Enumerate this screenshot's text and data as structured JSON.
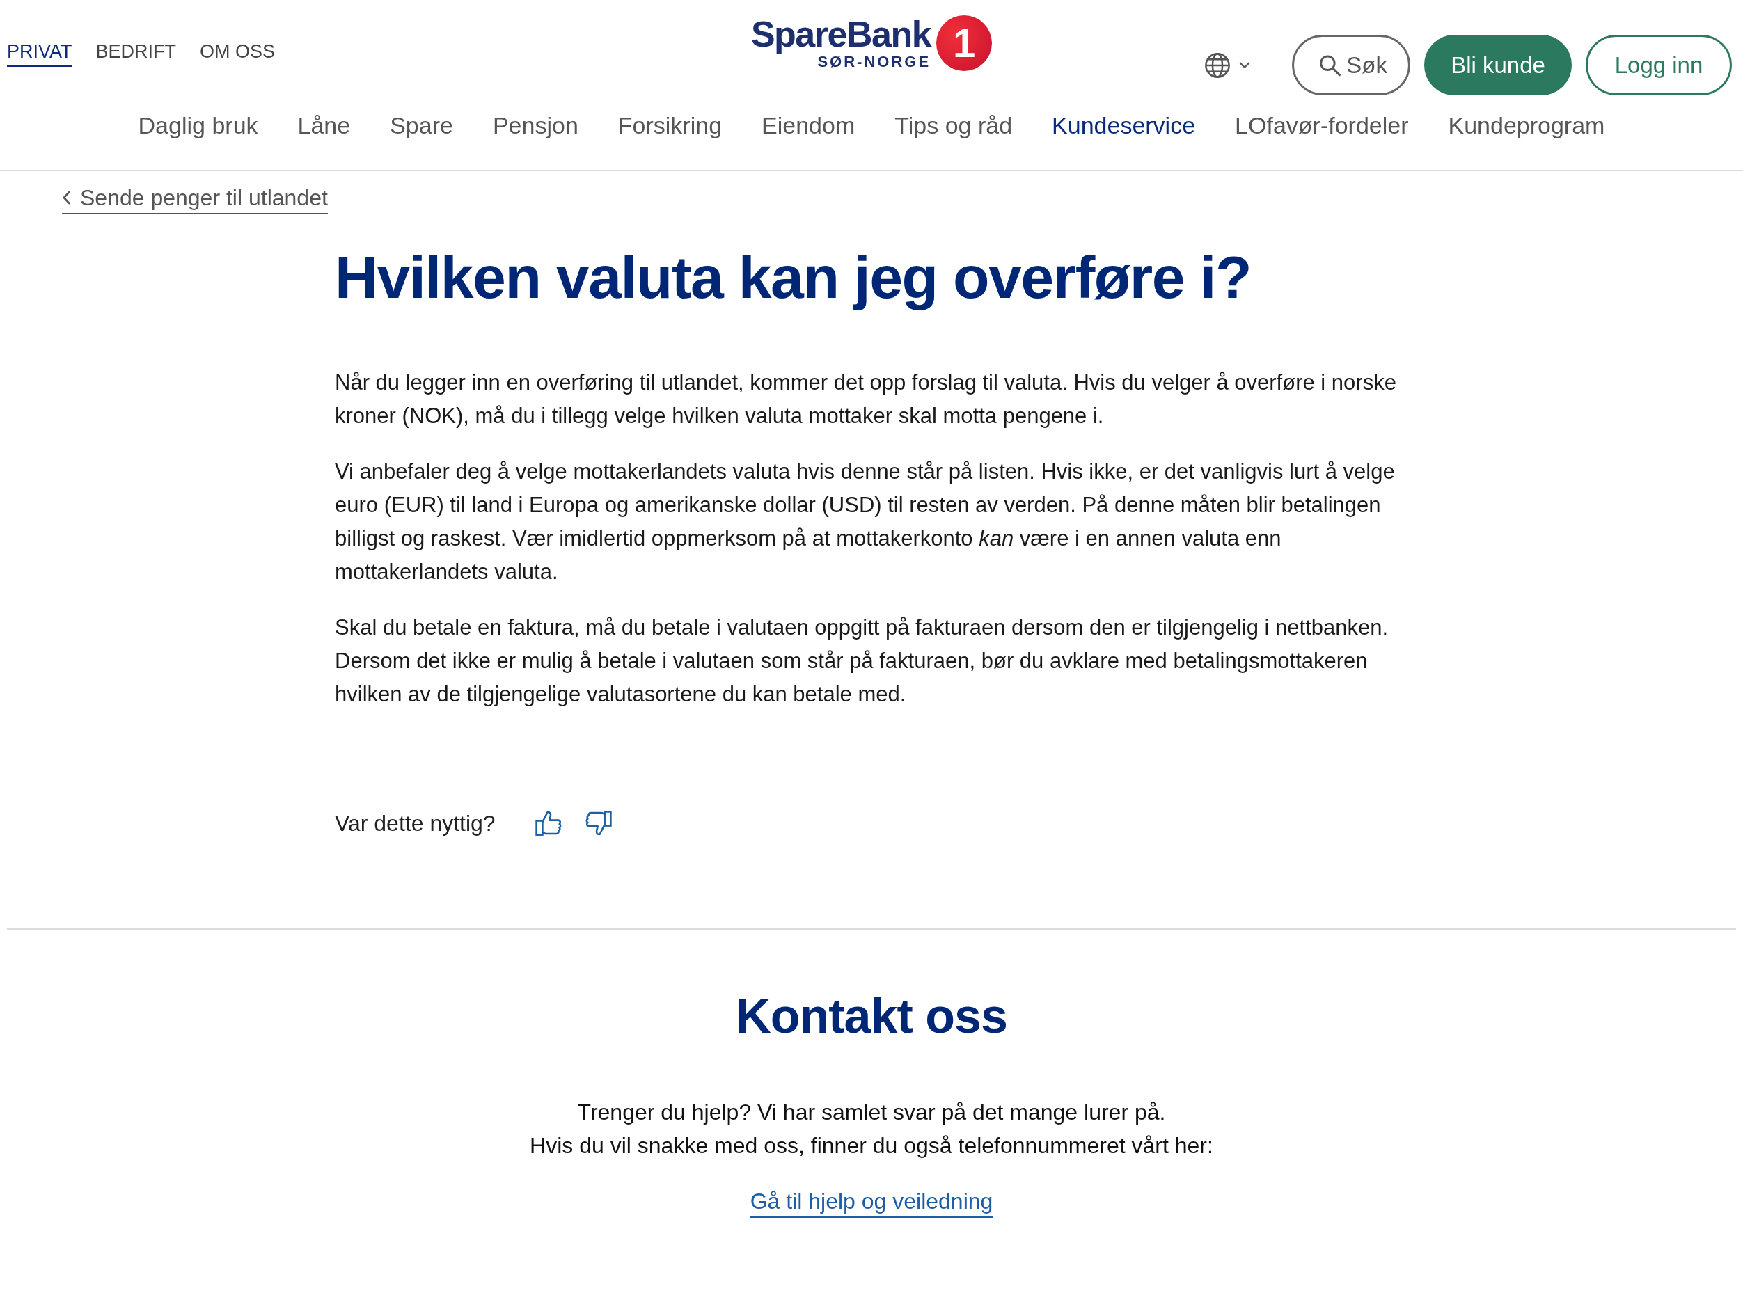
{
  "top_bar": {
    "segments": [
      {
        "label": "PRIVAT",
        "selected": true
      },
      {
        "label": "BEDRIFT",
        "selected": false
      },
      {
        "label": "OM OSS",
        "selected": false
      }
    ],
    "logo": {
      "name": "SpareBank",
      "region": "SØR-NORGE",
      "number": "1"
    },
    "buttons": [
      {
        "kind": "search",
        "label": "Søk"
      },
      {
        "kind": "primary",
        "label": "Bli kunde"
      },
      {
        "kind": "outline",
        "label": "Logg inn"
      }
    ]
  },
  "main_nav": [
    {
      "label": "Daglig bruk",
      "selected": false
    },
    {
      "label": "Låne",
      "selected": false
    },
    {
      "label": "Spare",
      "selected": false
    },
    {
      "label": "Pensjon",
      "selected": false
    },
    {
      "label": "Forsikring",
      "selected": false
    },
    {
      "label": "Eiendom",
      "selected": false
    },
    {
      "label": "Tips og råd",
      "selected": false
    },
    {
      "label": "Kundeservice",
      "selected": true
    },
    {
      "label": "LOfavør-fordeler",
      "selected": false
    },
    {
      "label": "Kundeprogram",
      "selected": false
    }
  ],
  "breadcrumb": {
    "back_link": "Sende penger til utlandet"
  },
  "article": {
    "title": "Hvilken valuta kan jeg overføre i?",
    "paragraphs": [
      "Når du legger inn en overføring til utlandet, kommer det opp forslag til valuta. Hvis du velger å overføre i norske kroner (NOK), må du i tillegg velge hvilken valuta mottaker skal motta pengene i.",
      "Vi anbefaler deg å velge mottakerlandets valuta hvis denne står på listen. Hvis ikke, er det vanligvis lurt å velge euro (EUR) til land i Europa og amerikanske dollar (USD) til resten av verden. På denne måten blir betalingen billigst og raskest. Vær imidlertid oppmerksom på at mottakerkonto *kan* være i en annen valuta enn mottakerlandets valuta.",
      "Skal du betale en faktura, må du betale i valutaen oppgitt på fakturaen dersom den er tilgjengelig i nettbanken. Dersom det ikke er mulig å betale i valutaen som står på fakturaen, bør du avklare med betalingsmottakeren hvilken av de tilgjengelige valutasortene du kan betale med."
    ]
  },
  "feedback": {
    "question": "Var dette nyttig?"
  },
  "contact": {
    "title": "Kontakt oss",
    "lines": [
      "Trenger du hjelp? Vi har samlet svar på det mange lurer på.",
      "Hvis du vil snakke med oss, finner du også telefonnummeret vårt her:"
    ],
    "link": "Gå til hjelp og veiledning"
  }
}
